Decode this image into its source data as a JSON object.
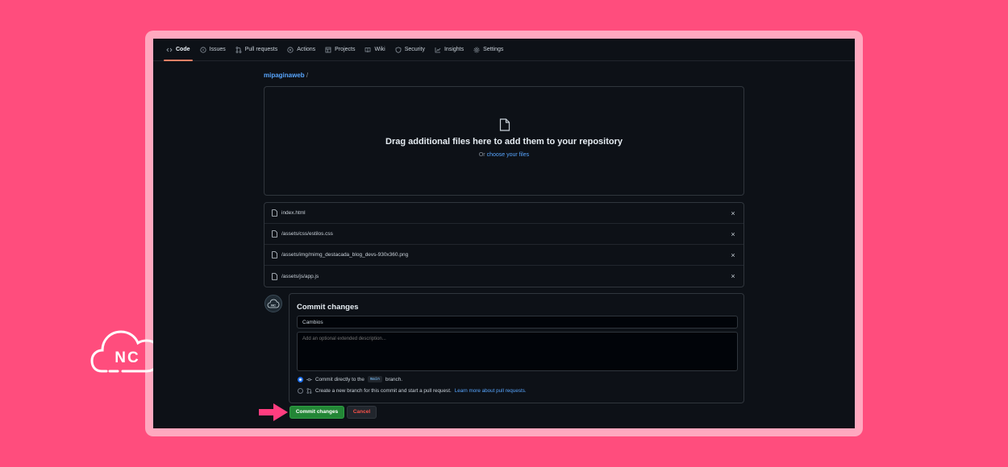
{
  "colors": {
    "background": "#ff4d7d",
    "frame": "#ffa8bf",
    "screen": "#0d1117",
    "link": "#58a6ff",
    "commit_button": "#238636",
    "cancel_text": "#f85149",
    "arrow": "#ff3d7f"
  },
  "brand": {
    "logo_text": "NC",
    "logo_icon": "cloud-icon"
  },
  "nav": {
    "items": [
      {
        "label": "Code",
        "icon": "code-icon",
        "active": true
      },
      {
        "label": "Issues",
        "icon": "issue-icon"
      },
      {
        "label": "Pull requests",
        "icon": "pull-request-icon"
      },
      {
        "label": "Actions",
        "icon": "play-icon"
      },
      {
        "label": "Projects",
        "icon": "table-icon"
      },
      {
        "label": "Wiki",
        "icon": "book-icon"
      },
      {
        "label": "Security",
        "icon": "shield-icon"
      },
      {
        "label": "Insights",
        "icon": "graph-icon"
      },
      {
        "label": "Settings",
        "icon": "gear-icon"
      }
    ]
  },
  "breadcrumb": {
    "repo": "mipaginaweb",
    "separator": "/"
  },
  "dropzone": {
    "icon": "file-icon",
    "title": "Drag additional files here to add them to your repository",
    "prefix": "Or",
    "link": "choose your files"
  },
  "files": [
    {
      "name": "index.html"
    },
    {
      "name": "/assets/css/estilos.css"
    },
    {
      "name": "/assets/img/mimg_destacada_blog_devs-930x360.png"
    },
    {
      "name": "/assets/js/app.js"
    }
  ],
  "file_remove_symbol": "×",
  "commit": {
    "avatar_text": "NC",
    "title": "Commit changes",
    "message": "Cambios",
    "description_placeholder": "Add an optional extended description...",
    "option_direct": {
      "prefix": "Commit directly to the",
      "branch": "main",
      "suffix": "branch.",
      "checked": true
    },
    "option_new": {
      "text": "Create a new branch for this commit and start a pull request.",
      "link": "Learn more about pull requests.",
      "checked": false
    },
    "submit_label": "Commit changes",
    "cancel_label": "Cancel"
  }
}
